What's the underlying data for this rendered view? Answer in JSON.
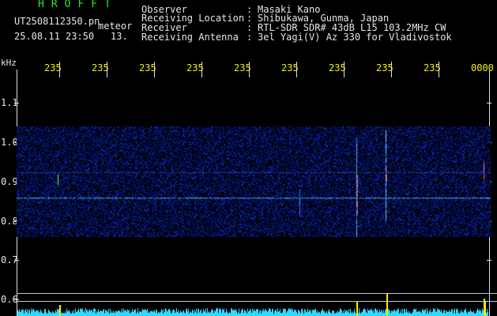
{
  "app": {
    "brand": "HROFFT",
    "filename": "UT2508112350.pn",
    "mode": "meteor",
    "datetime": "25.08.11 23:50",
    "number": "13."
  },
  "info": {
    "rows": [
      {
        "label": "Observer",
        "value": "Masaki Kano"
      },
      {
        "label": "Receiving Location",
        "value": "Shibukawa, Gunma, Japan"
      },
      {
        "label": "Receiver",
        "value": "RTL-SDR SDR# 43dB L15 103.2MHz CW"
      },
      {
        "label": "Receiving Antenna",
        "value": "3el Yagi(V) Az 330 for Vladivostok"
      }
    ]
  },
  "axis": {
    "unit": "kHz",
    "time_labels": [
      "235",
      "235",
      "235",
      "235",
      "235",
      "235",
      "235",
      "235",
      "235",
      "0000"
    ],
    "freq_labels": [
      "1.1",
      "1.0",
      "0.9",
      "0.8",
      "0.7",
      "0.6"
    ]
  },
  "colors": {
    "text_green": "#2ee62e",
    "text_white": "#e6e6e6",
    "text_yellow": "#f0f000",
    "noise_blue": "#1a2ad0",
    "trace_cyan": "#40b8ff",
    "spectrum_cyan": "#30d8ff"
  }
}
